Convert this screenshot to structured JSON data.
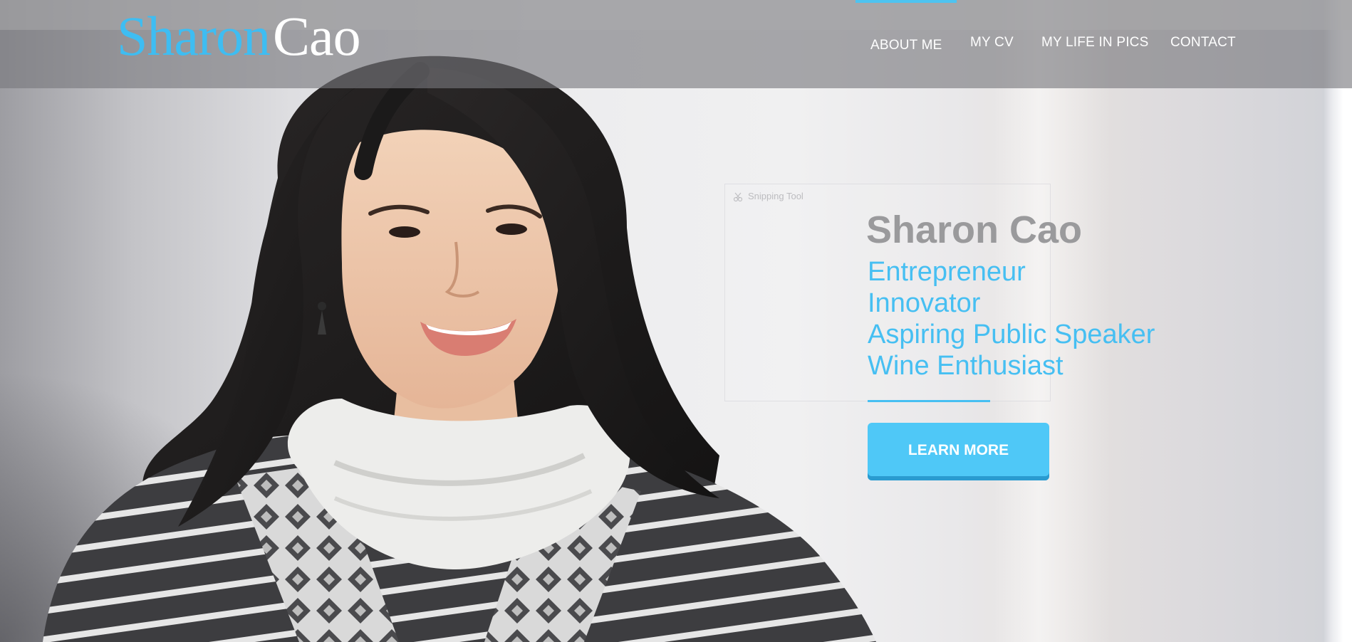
{
  "logo": {
    "first": "Sharon",
    "last": "Cao"
  },
  "nav": [
    {
      "label": "ABOUT ME",
      "active": true
    },
    {
      "label": "MY CV"
    },
    {
      "label": "MY LIFE IN PICS"
    },
    {
      "label": "CONTACT"
    }
  ],
  "overlay": {
    "label": "Snipping Tool"
  },
  "hero": {
    "name": "Sharon Cao",
    "roles": [
      "Entrepreneur",
      "Innovator",
      "Aspiring Public Speaker",
      "Wine Enthusiast"
    ],
    "cta": "LEARN MORE"
  },
  "colors": {
    "brand_blue": "#3ebdf2",
    "button_blue": "#4fc8f7",
    "name_gray": "#9a9a9c"
  }
}
